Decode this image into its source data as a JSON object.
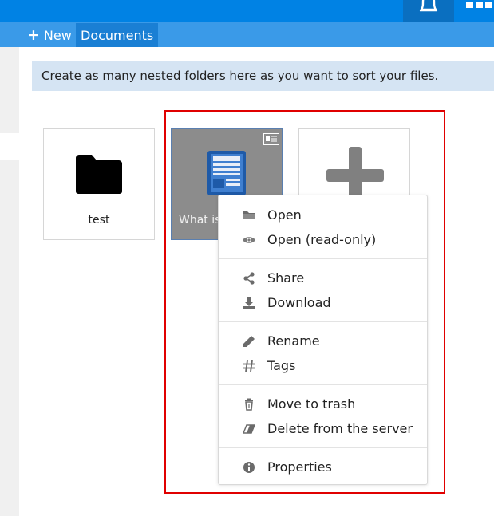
{
  "breadcrumb": {
    "new_label": "New",
    "current": "Documents"
  },
  "banner": {
    "text": "Create as many nested folders here as you want to sort your files."
  },
  "files": [
    {
      "name": "test",
      "type": "folder"
    },
    {
      "name": "What is",
      "type": "document"
    },
    {
      "name": "",
      "type": "new"
    }
  ],
  "context_menu": {
    "groups": [
      [
        {
          "label": "Open",
          "icon": "folder-icon"
        },
        {
          "label": "Open (read-only)",
          "icon": "eye-icon"
        }
      ],
      [
        {
          "label": "Share",
          "icon": "share-icon"
        },
        {
          "label": "Download",
          "icon": "download-icon"
        }
      ],
      [
        {
          "label": "Rename",
          "icon": "pencil-icon"
        },
        {
          "label": "Tags",
          "icon": "hashtag-icon"
        }
      ],
      [
        {
          "label": "Move to trash",
          "icon": "trash-icon"
        },
        {
          "label": "Delete from the server",
          "icon": "eraser-icon"
        }
      ],
      [
        {
          "label": "Properties",
          "icon": "info-icon"
        }
      ]
    ]
  },
  "colors": {
    "topbar": "#0082e4",
    "crumbbar": "#3a9ae8",
    "banner": "#d5e4f3",
    "highlight": "#e00000",
    "doc_icon": "#1e5aa8"
  }
}
